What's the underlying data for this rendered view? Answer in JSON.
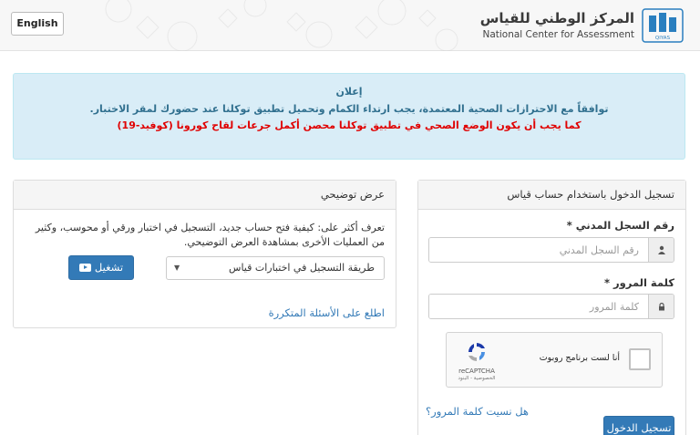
{
  "header": {
    "language_button": "English",
    "brand_arabic": "المركز الوطني للقياس",
    "brand_english": "National Center for Assessment",
    "logo_subtext": "QIYAS"
  },
  "notice": {
    "title": "إعلان",
    "line1": "توافقاً مع الاحترازات الصحية المعتمدة، يجب ارتداء الكمام وتحميل تطبيق توكلنا عند حضورك لمقر الاختبار.",
    "line2": "كما يجب أن يكون الوضع الصحي في تطبيق توكلنا محصن أكمل جرعات لقاح كورونا (كوفيد-19)"
  },
  "login": {
    "panel_title": "تسجيل الدخول باستخدام حساب قياس",
    "id_label": "رقم السجل المدني *",
    "id_placeholder": "رقم السجل المدني",
    "password_label": "كلمة المرور *",
    "password_placeholder": "كلمة المرور",
    "recaptcha_label": "أنا لست برنامج روبوت",
    "recaptcha_name": "reCAPTCHA",
    "recaptcha_terms": "الخصوصية - البنود",
    "forgot_link": "هل نسيت كلمة المرور؟",
    "submit_button": "تسجيل الدخول"
  },
  "demo": {
    "panel_title": "عرض توضيحي",
    "description": "تعرف أكثر على: كيفية فتح حساب جديد، التسجيل في اختبار ورقي أو محوسب، وكثير من العمليات الأخرى بمشاهدة العرض التوضيحي.",
    "selected_option": "طريقة التسجيل في اختبارات قياس",
    "play_button": "تشغيل",
    "faq_link": "اطلع على الأسئلة المتكررة"
  },
  "colors": {
    "primary": "#337ab7",
    "notice_bg": "#d9edf7",
    "notice_text": "#31708f",
    "alert_red": "#e00000",
    "logo_blue": "#2a7fbf"
  }
}
